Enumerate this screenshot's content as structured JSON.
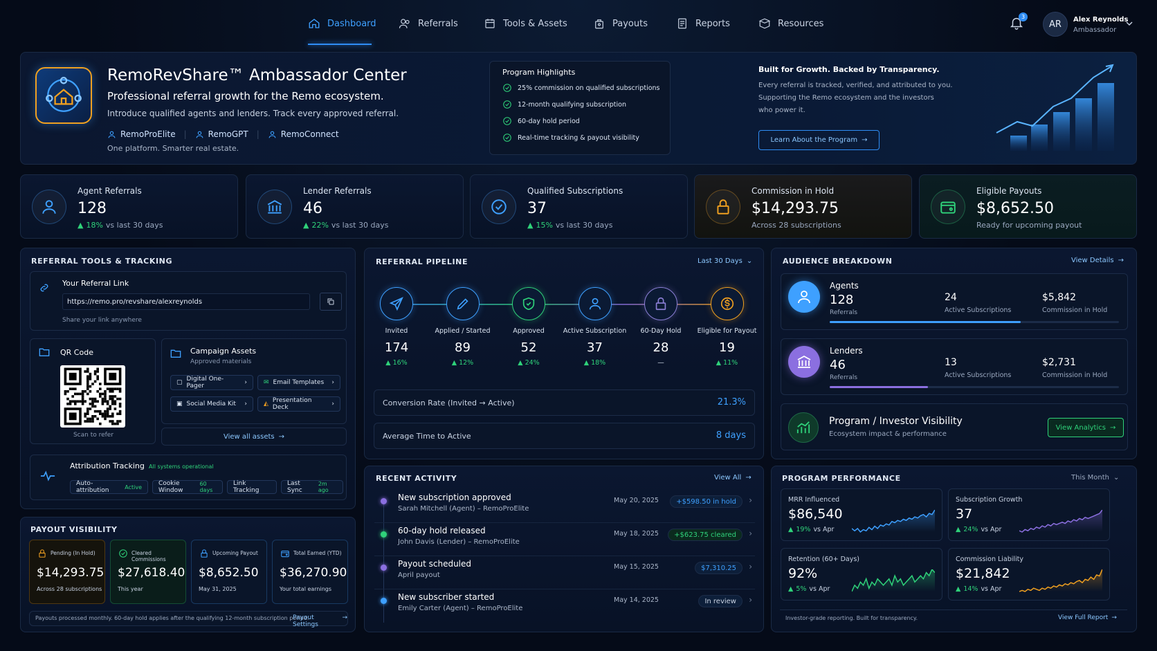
{
  "nav": {
    "items": [
      {
        "label": "Dashboard",
        "icon": "home-icon"
      },
      {
        "label": "Referrals",
        "icon": "users-icon"
      },
      {
        "label": "Tools & Assets",
        "icon": "calendar-icon"
      },
      {
        "label": "Payouts",
        "icon": "bag-icon"
      },
      {
        "label": "Reports",
        "icon": "report-icon"
      },
      {
        "label": "Resources",
        "icon": "box-icon"
      }
    ],
    "notif_count": "3",
    "user": {
      "initials": "AR",
      "name": "Alex Reynolds",
      "role": "Ambassador"
    }
  },
  "hero": {
    "title": "RemoRevShare™ Ambassador Center",
    "tagline": "Professional referral growth for the Remo ecosystem.",
    "desc": "Introduce qualified agents and lenders. Track every approved referral.",
    "brands": [
      "RemoProElite",
      "RemoGPT",
      "RemoConnect"
    ],
    "footer": "One platform. Smarter real estate.",
    "highlights": {
      "title": "Program Highlights",
      "items": [
        "25% commission on qualified subscriptions",
        "12-month qualifying subscription",
        "60-day hold period",
        "Real-time tracking & payout visibility"
      ]
    },
    "growth": {
      "title": "Built for Growth. Backed by Transparency.",
      "body1": "Every referral is tracked, verified, and attributed to you.",
      "body2": "Supporting the Remo ecosystem and the investors",
      "body3": "who power it.",
      "button": "Learn About the Program"
    }
  },
  "stats": [
    {
      "title": "Agent Referrals",
      "value": "128",
      "delta": "18%",
      "note": "vs last 30 days",
      "icon": "user-icon",
      "color": "#3ea0ff"
    },
    {
      "title": "Lender Referrals",
      "value": "46",
      "delta": "22%",
      "note": "vs last 30 days",
      "icon": "bank-icon",
      "color": "#3ea0ff"
    },
    {
      "title": "Qualified Subscriptions",
      "value": "37",
      "delta": "15%",
      "note": "vs last 30 days",
      "icon": "check-circle-icon",
      "color": "#3ea0ff"
    },
    {
      "title": "Commission in Hold",
      "value": "$14,293.75",
      "delta": "",
      "note": "Across 28 subscriptions",
      "icon": "lock-icon",
      "color": "#f0a020"
    },
    {
      "title": "Eligible Payouts",
      "value": "$8,652.50",
      "delta": "",
      "note": "Ready for upcoming payout",
      "icon": "wallet-icon",
      "color": "#2fd27a"
    }
  ],
  "tools": {
    "header": "REFERRAL TOOLS & TRACKING",
    "link_title": "Your Referral Link",
    "link_url": "https://remo.pro/revshare/alexreynolds",
    "link_hint": "Share your link anywhere",
    "qr_title": "QR Code",
    "qr_hint": "Scan to refer",
    "campaign_title": "Campaign Assets",
    "campaign_sub": "Approved materials",
    "assets": [
      "Digital One-Pager",
      "Email Templates",
      "Social Media Kit",
      "Presentation Deck"
    ],
    "view_assets": "View all assets",
    "attr_title": "Attribution Tracking",
    "attr_status": "All systems operational",
    "attr_chips": [
      {
        "label": "Auto-attribution",
        "value": "Active"
      },
      {
        "label": "Cookie Window",
        "value": "60 days"
      },
      {
        "label": "Link Tracking",
        "value": ""
      },
      {
        "label": "Last Sync",
        "value": "2m ago"
      }
    ]
  },
  "payout": {
    "header": "PAYOUT VISIBILITY",
    "cards": [
      {
        "label": "Pending (In Hold)",
        "value": "$14,293.75",
        "note": "Across 28 subscriptions",
        "color": "#f0a020"
      },
      {
        "label": "Cleared Commissions",
        "value": "$27,618.40",
        "note": "This year",
        "color": "#2fd27a"
      },
      {
        "label": "Upcoming Payout",
        "value": "$8,652.50",
        "note": "May 31, 2025",
        "color": "#3ea0ff"
      },
      {
        "label": "Total Earned (YTD)",
        "value": "$36,270.90",
        "note": "Your total earnings",
        "color": "#3ea0ff"
      }
    ],
    "footer": "Payouts processed monthly. 60-day hold applies after the qualifying 12-month subscription period.",
    "settings": "Payout Settings"
  },
  "pipeline": {
    "header": "REFERRAL PIPELINE",
    "range": "Last 30 Days",
    "stages": [
      {
        "label": "Invited",
        "value": "174",
        "delta": "16%",
        "icon": "send-icon",
        "color": "#3ea0ff"
      },
      {
        "label": "Applied / Started",
        "value": "89",
        "delta": "12%",
        "icon": "pencil-icon",
        "color": "#3ea0ff"
      },
      {
        "label": "Approved",
        "value": "52",
        "delta": "24%",
        "icon": "shield-icon",
        "color": "#2fd27a"
      },
      {
        "label": "Active Subscription",
        "value": "37",
        "delta": "18%",
        "icon": "user-icon",
        "color": "#3ea0ff"
      },
      {
        "label": "60-Day Hold",
        "value": "28",
        "delta": "—",
        "icon": "lock-icon",
        "color": "#8b7fd6"
      },
      {
        "label": "Eligible for Payout",
        "value": "19",
        "delta": "11%",
        "icon": "dollar-icon",
        "color": "#f0a020"
      }
    ],
    "conv_label": "Conversion Rate (Invited → Active)",
    "conv_value": "21.3%",
    "avg_label": "Average Time to Active",
    "avg_value": "8 days"
  },
  "activity": {
    "header": "RECENT ACTIVITY",
    "view": "View All",
    "items": [
      {
        "title": "New subscription approved",
        "sub": "Sarah Mitchell (Agent) – RemoProElite",
        "date": "May 20, 2025",
        "amount": "+$598.50 in hold",
        "dot": "#8b6fe0",
        "pill": "#3ea0ff"
      },
      {
        "title": "60-day hold released",
        "sub": "John Davis (Lender) – RemoProElite",
        "date": "May 18, 2025",
        "amount": "+$623.75 cleared",
        "dot": "#2fd27a",
        "pill": "#2fd27a"
      },
      {
        "title": "Payout scheduled",
        "sub": "April payout",
        "date": "May 15, 2025",
        "amount": "$7,310.25",
        "dot": "#8b6fe0",
        "pill": "#3ea0ff"
      },
      {
        "title": "New subscriber started",
        "sub": "Emily Carter (Agent) – RemoProElite",
        "date": "May 14, 2025",
        "amount": "In review",
        "dot": "#3ea0ff",
        "pill": "#c9d3e3"
      }
    ]
  },
  "audience": {
    "header": "AUDIENCE BREAKDOWN",
    "view": "View Details",
    "groups": [
      {
        "name": "Agents",
        "value": "128",
        "unit": "Referrals",
        "subs": "24",
        "subs_label": "Active Subscriptions",
        "comm": "$5,842",
        "comm_label": "Commission in Hold",
        "progress": 0.66,
        "color": "#3ea0ff"
      },
      {
        "name": "Lenders",
        "value": "46",
        "unit": "Referrals",
        "subs": "13",
        "subs_label": "Active Subscriptions",
        "comm": "$2,731",
        "comm_label": "Commission in Hold",
        "progress": 0.34,
        "color": "#8b6fe0"
      }
    ],
    "vis_title": "Program / Investor Visibility",
    "vis_sub": "Ecosystem impact & performance",
    "vis_button": "View Analytics"
  },
  "performance": {
    "header": "PROGRAM PERFORMANCE",
    "range": "This Month",
    "cards": [
      {
        "label": "MRR Influenced",
        "value": "$86,540",
        "delta": "19%",
        "note": "vs Apr",
        "color": "#3ea0ff"
      },
      {
        "label": "Subscription Growth",
        "value": "37",
        "delta": "24%",
        "note": "vs Apr",
        "color": "#8b6fe0"
      },
      {
        "label": "Retention (60+ Days)",
        "value": "92%",
        "delta": "5%",
        "note": "vs Apr",
        "color": "#2fd27a"
      },
      {
        "label": "Commission Liability",
        "value": "$21,842",
        "delta": "14%",
        "note": "vs Apr",
        "color": "#f0a020"
      }
    ],
    "footer": "Investor-grade reporting. Built for transparency.",
    "view": "View Full Report"
  }
}
